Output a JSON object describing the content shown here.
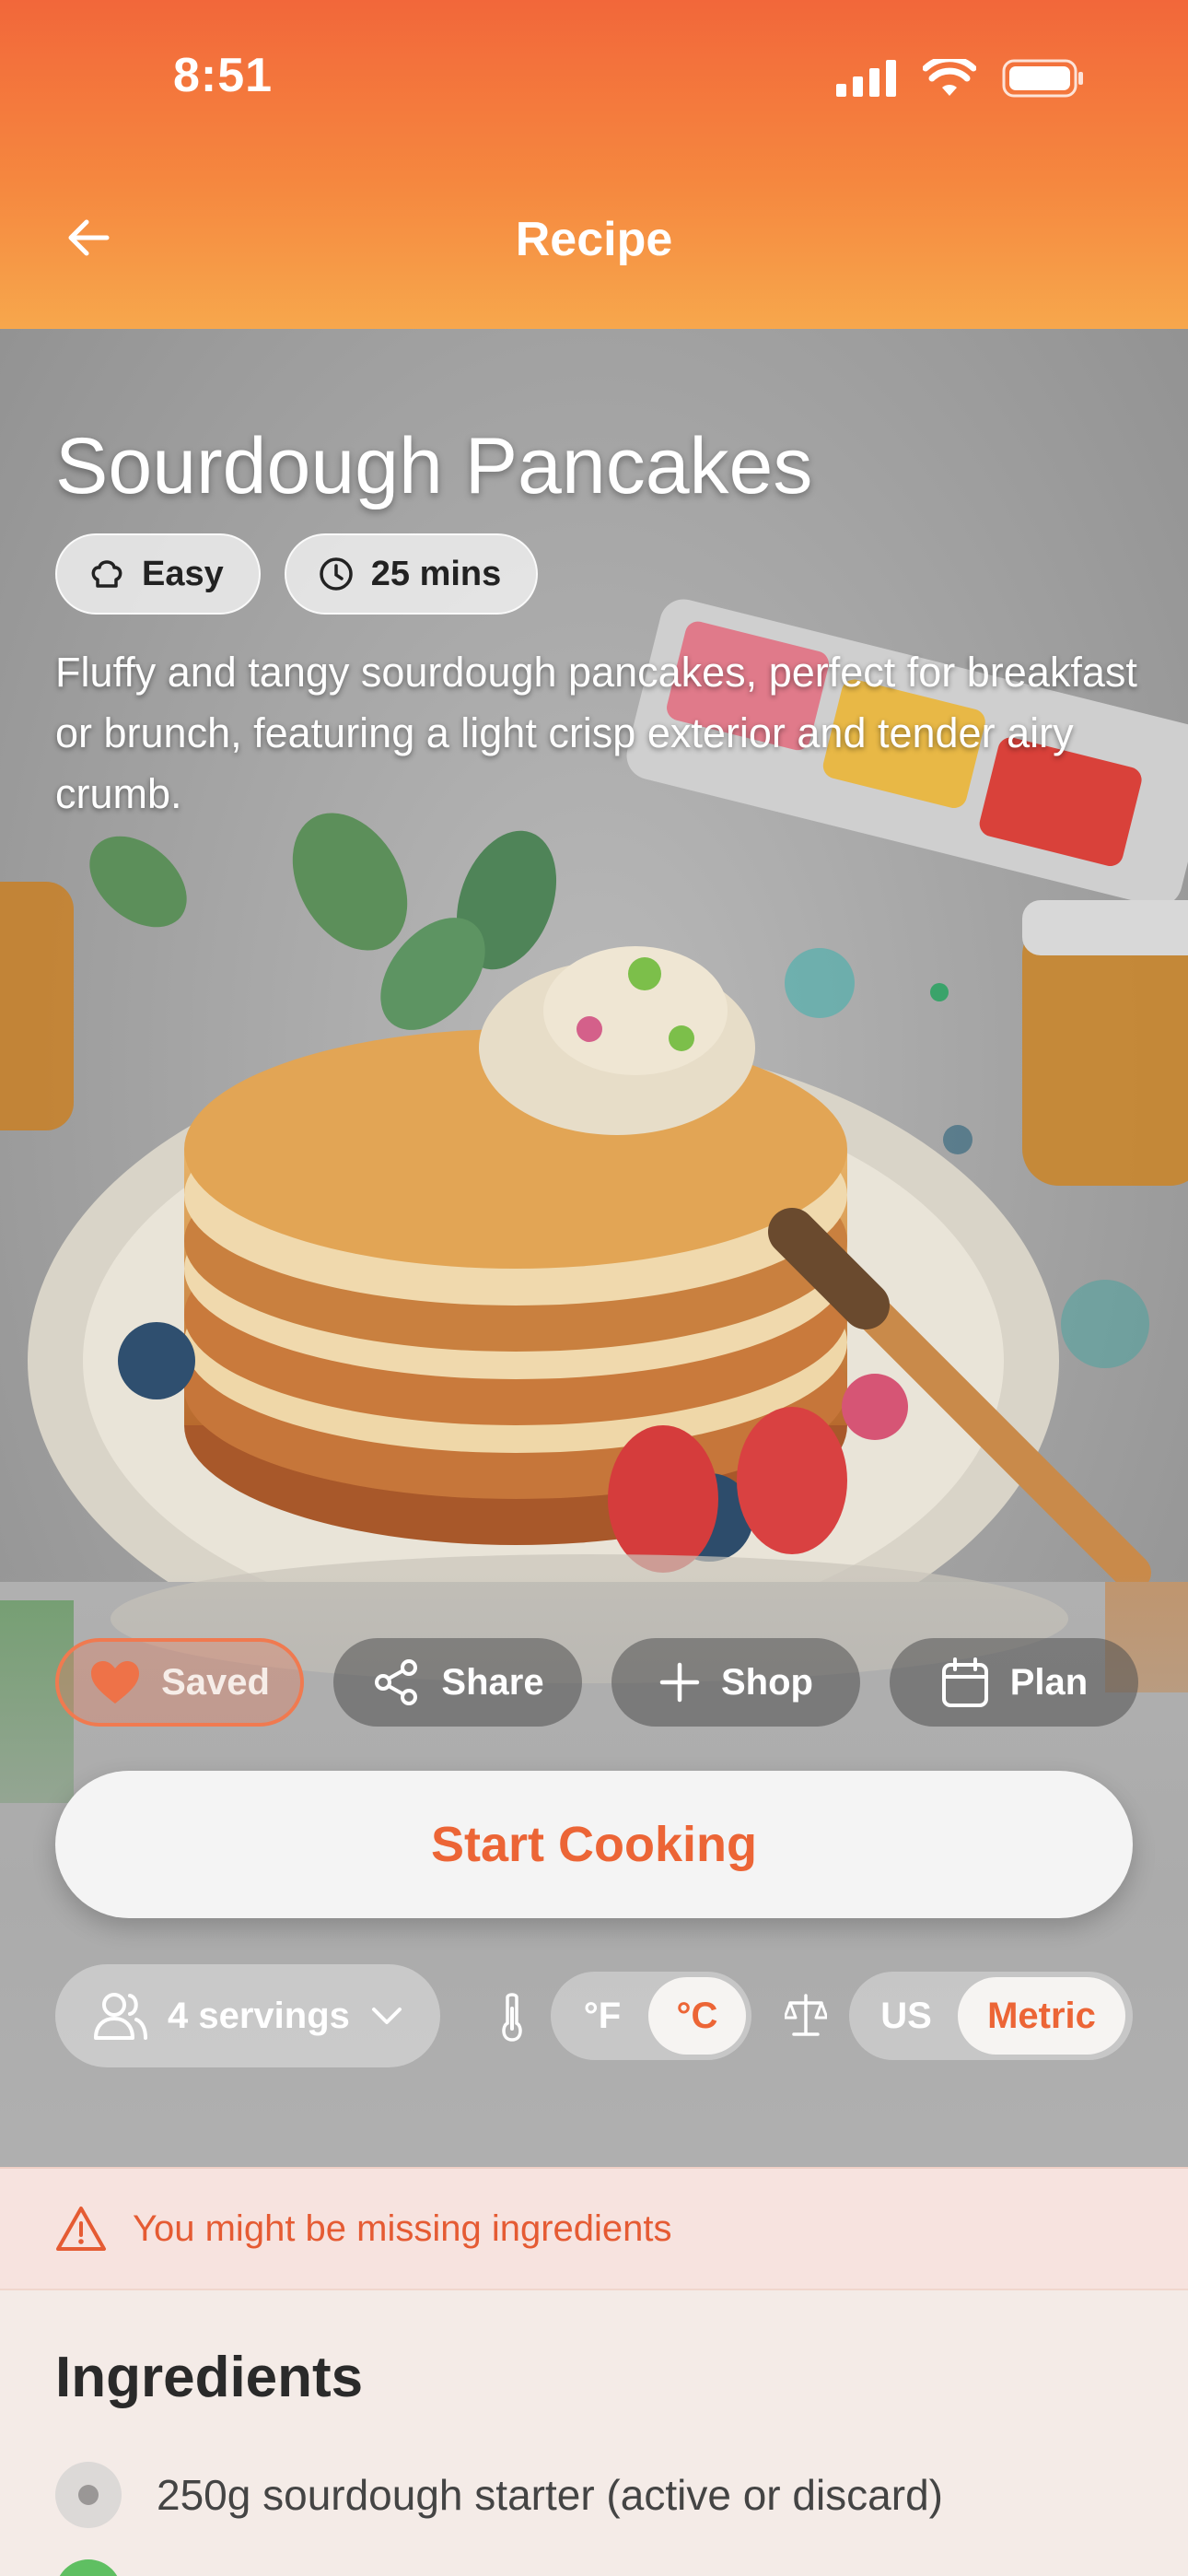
{
  "status_bar": {
    "time": "8:51"
  },
  "header": {
    "title": "Recipe",
    "back_icon": "arrow-left-icon"
  },
  "recipe": {
    "title": "Sourdough Pancakes",
    "difficulty": "Easy",
    "duration": "25 mins",
    "description": "Fluffy and tangy sourdough pancakes, perfect for breakfast or brunch, featuring a light crisp exterior and tender airy crumb."
  },
  "actions": {
    "saved": "Saved",
    "share": "Share",
    "shop": "Shop",
    "plan": "Plan"
  },
  "start_cooking": "Start Cooking",
  "controls": {
    "servings": "4 servings",
    "temp_f": "°F",
    "temp_c": "°C",
    "temp_selected": "°C",
    "units_us": "US",
    "units_metric": "Metric",
    "units_selected": "Metric"
  },
  "warning": {
    "text": "You might be missing ingredients"
  },
  "ingredients": {
    "title": "Ingredients",
    "items": [
      {
        "label": "250g sourdough starter (active or discard)"
      }
    ]
  },
  "colors": {
    "accent": "#ec6536",
    "header_top": "#f2673a",
    "header_bottom": "#f7a74c",
    "warning_bg": "#f7e3df"
  }
}
